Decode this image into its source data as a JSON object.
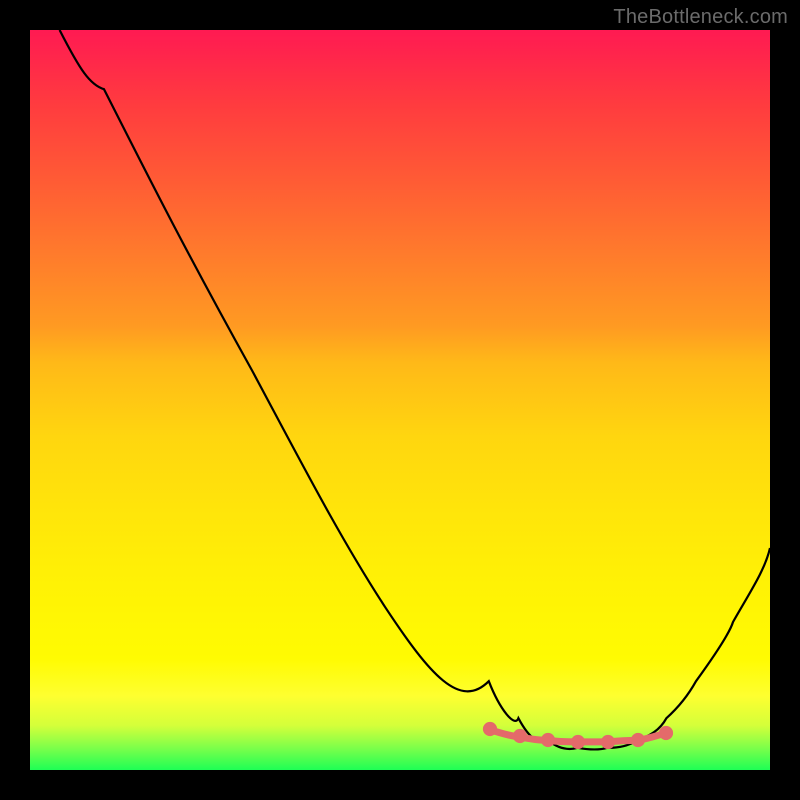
{
  "watermark": "TheBottleneck.com",
  "colors": {
    "gradient_top": "#ff1a52",
    "gradient_bottom": "#1eff55",
    "curve_black": "#000000",
    "curve_pink": "#e46a6a",
    "background": "#000000"
  },
  "chart_data": {
    "type": "line",
    "title": "",
    "xlabel": "",
    "ylabel": "",
    "xlim": [
      0,
      100
    ],
    "ylim": [
      0,
      100
    ],
    "grid": false,
    "legend": false,
    "series": [
      {
        "name": "bottleneck-curve",
        "color": "#000000",
        "x": [
          4,
          10,
          20,
          30,
          40,
          48,
          56,
          62,
          66,
          70,
          74,
          78,
          82,
          86,
          90,
          95,
          100
        ],
        "y": [
          100,
          92,
          78,
          64,
          49,
          36,
          22,
          12,
          7,
          4,
          3,
          3,
          4,
          7,
          12,
          20,
          30
        ]
      },
      {
        "name": "valley-highlight",
        "color": "#e46a6a",
        "x": [
          62,
          66,
          70,
          74,
          78,
          82,
          86
        ],
        "y": [
          5.5,
          4.5,
          4,
          3.8,
          3.8,
          4,
          5
        ]
      }
    ]
  }
}
